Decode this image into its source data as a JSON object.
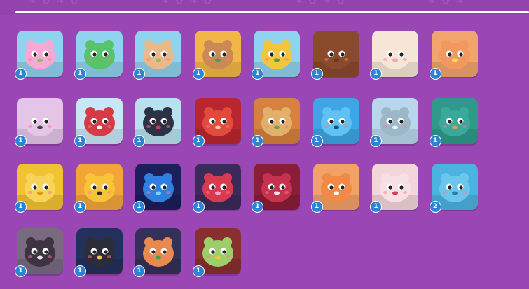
{
  "inventory": {
    "items": [
      {
        "id": "pink-frog",
        "count": "1",
        "bg": "#8fd3ee",
        "body": "#f7a8d4",
        "accent": "#7bc867",
        "icon": "frog-icon"
      },
      {
        "id": "green-frog",
        "count": "1",
        "bg": "#8fd3ee",
        "body": "#56c46b",
        "accent": "#6ab85c",
        "icon": "clover-frog-icon"
      },
      {
        "id": "flower-frog",
        "count": "1",
        "bg": "#8fd3ee",
        "body": "#e9b98a",
        "accent": "#7bc867",
        "icon": "flower-crown-frog-icon"
      },
      {
        "id": "leprechaun-bear",
        "count": "1",
        "bg": "#f2b648",
        "body": "#c98a55",
        "accent": "#3aa457",
        "icon": "leprechaun-bear-icon"
      },
      {
        "id": "bee-clover",
        "count": "1",
        "bg": "#8fd3ee",
        "body": "#f2c53a",
        "accent": "#3aa457",
        "icon": "bee-icon"
      },
      {
        "id": "chocolate-bunny",
        "count": "1",
        "bg": "#8a4a2c",
        "body": "#8a4a2c",
        "accent": "#6d3720",
        "icon": "chocolate-bunny-icon"
      },
      {
        "id": "llama-glasses",
        "count": "1",
        "bg": "#f6e6d8",
        "body": "#f6e6d8",
        "accent": "#f2a5b7",
        "icon": "llama-icon"
      },
      {
        "id": "flower-deer",
        "count": "1",
        "bg": "#f2a46e",
        "body": "#f29a5e",
        "accent": "#f7d85a",
        "icon": "flower-deer-icon"
      },
      {
        "id": "pufferfish",
        "count": "1",
        "bg": "#e4c5e7",
        "body": "#e4c5e7",
        "accent": "#444444",
        "icon": "pufferfish-icon"
      },
      {
        "id": "snowman-sweater",
        "count": "1",
        "bg": "#c9e6f4",
        "body": "#d53b45",
        "accent": "#ffffff",
        "icon": "snowman-icon"
      },
      {
        "id": "penguin-hat",
        "count": "1",
        "bg": "#b8e0ef",
        "body": "#2d3145",
        "accent": "#d53b45",
        "icon": "penguin-icon"
      },
      {
        "id": "red-crab",
        "count": "1",
        "bg": "#b8262f",
        "body": "#e24a3c",
        "accent": "#f2c6b5",
        "icon": "crab-icon"
      },
      {
        "id": "sandwich",
        "count": "1",
        "bg": "#d6813d",
        "body": "#e2b06b",
        "accent": "#5fa84d",
        "icon": "sandwich-icon"
      },
      {
        "id": "blue-slime",
        "count": "1",
        "bg": "#3ea6e6",
        "body": "#5fc2f2",
        "accent": "#1d4e73",
        "icon": "slime-icon"
      },
      {
        "id": "frozen-fish",
        "count": "1",
        "bg": "#b9d7ea",
        "body": "#9bb7c8",
        "accent": "#e8f3fa",
        "icon": "frozen-fish-icon"
      },
      {
        "id": "platypus",
        "count": "1",
        "bg": "#2f9a8c",
        "body": "#3aa99a",
        "accent": "#e79a45",
        "icon": "platypus-icon"
      },
      {
        "id": "golden-envelope",
        "count": "1",
        "bg": "#f1c232",
        "body": "#f7d35a",
        "accent": "#d89b14",
        "icon": "envelope-icon"
      },
      {
        "id": "sunflower-bird",
        "count": "1",
        "bg": "#f2a63a",
        "body": "#f7c439",
        "accent": "#3a2a20",
        "icon": "sunflower-bird-icon"
      },
      {
        "id": "blue-moth",
        "count": "1",
        "bg": "#1b1f5a",
        "body": "#2f7fe0",
        "accent": "#7fd0ff",
        "icon": "moth-icon"
      },
      {
        "id": "heart-planet",
        "count": "1",
        "bg": "#3b2a5a",
        "body": "#d93b4e",
        "accent": "#f2a7c4",
        "icon": "heart-planet-icon"
      },
      {
        "id": "red-peacock",
        "count": "1",
        "bg": "#8b1d38",
        "body": "#c7324f",
        "accent": "#f2e3ea",
        "icon": "peacock-icon"
      },
      {
        "id": "fox",
        "count": "1",
        "bg": "#f2a168",
        "body": "#f08a45",
        "accent": "#ffffff",
        "icon": "fox-icon"
      },
      {
        "id": "bunny-bow",
        "count": "1",
        "bg": "#f3d6dc",
        "body": "#f7e0e4",
        "accent": "#d63b56",
        "icon": "bunny-icon"
      },
      {
        "id": "blue-bear",
        "count": "2",
        "bg": "#4cb3e0",
        "body": "#6ac6ec",
        "accent": "#2a7fa6",
        "icon": "gummy-bear-icon"
      },
      {
        "id": "fish-skeleton-jar",
        "count": "1",
        "bg": "#7a6a80",
        "body": "#3d3342",
        "accent": "#e9e3ea",
        "icon": "fish-skeleton-icon"
      },
      {
        "id": "ninja-cat-space",
        "count": "1",
        "bg": "#24305c",
        "body": "#2d2d3a",
        "accent": "#f2c53a",
        "icon": "ninja-cat-icon"
      },
      {
        "id": "leprechaun-chest",
        "count": "1",
        "bg": "#35305a",
        "body": "#e88a4e",
        "accent": "#3aa457",
        "icon": "leprechaun-chest-icon"
      },
      {
        "id": "bookworm",
        "count": "1",
        "bg": "#8a2f2f",
        "body": "#9ccf6a",
        "accent": "#f2c53a",
        "icon": "bookworm-icon"
      }
    ]
  }
}
